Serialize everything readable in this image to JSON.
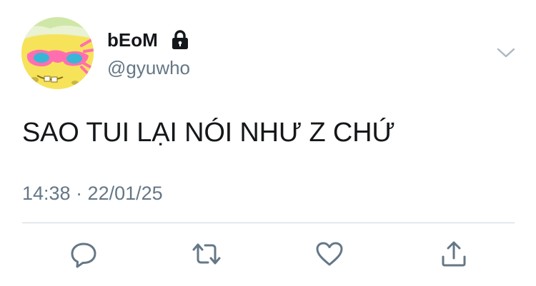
{
  "profile": {
    "display_name": "bEoM",
    "handle": "@gyuwho"
  },
  "tweet": {
    "text": "SAO TUI LẠI NÓI NHƯ Z CHỨ",
    "timestamp": "14:38 · 22/01/25"
  },
  "icons": {
    "avatar": "spongebob-sunglasses-avatar",
    "lock": "lock-icon",
    "menu": "chevron-down-icon",
    "reply": "reply-icon",
    "retweet": "retweet-icon",
    "like": "heart-icon",
    "share": "share-icon"
  },
  "colors": {
    "text_primary": "#14171a",
    "text_secondary": "#657786",
    "icon": "#657786",
    "divider": "#cdd6dd"
  }
}
